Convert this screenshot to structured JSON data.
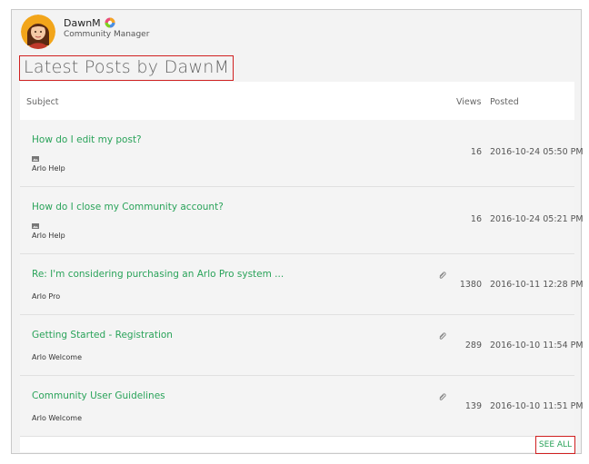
{
  "profile": {
    "username": "DawnM",
    "role": "Community Manager"
  },
  "heading": "Latest Posts by DawnM",
  "table": {
    "headers": {
      "subject": "Subject",
      "views": "Views",
      "posted": "Posted"
    },
    "rows": [
      {
        "subject": "How do I edit my post?",
        "board": "Arlo Help",
        "views": "16",
        "posted": "2016-10-24 05:50 PM",
        "has_image": true,
        "has_attachment": false
      },
      {
        "subject": "How do I close my Community account?",
        "board": "Arlo Help",
        "views": "16",
        "posted": "2016-10-24 05:21 PM",
        "has_image": true,
        "has_attachment": false
      },
      {
        "subject": "Re: I'm considering purchasing an Arlo Pro system ...",
        "board": "Arlo Pro",
        "views": "1380",
        "posted": "2016-10-11 12:28 PM",
        "has_image": false,
        "has_attachment": true
      },
      {
        "subject": "Getting Started - Registration",
        "board": "Arlo Welcome",
        "views": "289",
        "posted": "2016-10-10 11:54 PM",
        "has_image": false,
        "has_attachment": true
      },
      {
        "subject": "Community User Guidelines",
        "board": "Arlo Welcome",
        "views": "139",
        "posted": "2016-10-10 11:51 PM",
        "has_image": false,
        "has_attachment": true
      }
    ]
  },
  "see_all": "SEE ALL",
  "colors": {
    "link": "#2aa35a",
    "highlight_border": "#d02020"
  }
}
